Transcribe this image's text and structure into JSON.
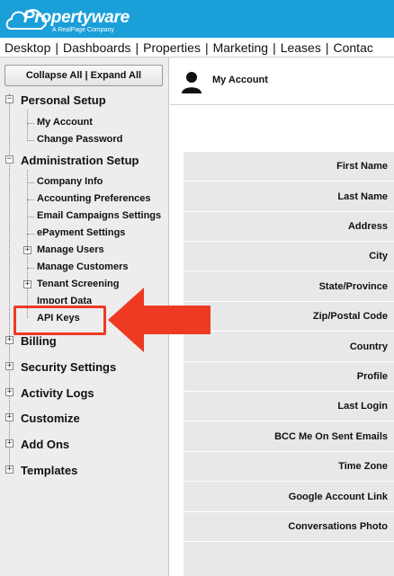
{
  "header": {
    "logo_text": "Propertyware",
    "logo_sub": "A RealPage Company"
  },
  "nav": {
    "items": [
      "Desktop",
      "Dashboards",
      "Properties",
      "Marketing",
      "Leases",
      "Contac"
    ]
  },
  "sidebar": {
    "collapse_all": "Collapse All",
    "expand_all": "Expand All",
    "sections": {
      "personal": "Personal Setup",
      "admin": "Administration Setup",
      "billing": "Billing",
      "security": "Security Settings",
      "activity": "Activity Logs",
      "customize": "Customize",
      "addons": "Add Ons",
      "templates": "Templates"
    },
    "personal_items": [
      "My Account",
      "Change Password"
    ],
    "admin_items": [
      "Company Info",
      "Accounting Preferences",
      "Email Campaigns Settings",
      "ePayment Settings",
      "Manage Users",
      "Manage Customers",
      "Tenant Screening",
      "Import Data",
      "API Keys"
    ]
  },
  "main": {
    "title": "My Account",
    "fields": [
      "First Name",
      "Last Name",
      "Address",
      "City",
      "State/Province",
      "Zip/Postal Code",
      "Country",
      "Profile",
      "Last Login",
      "BCC Me On Sent Emails",
      "Time Zone",
      "Google Account Link",
      "Conversations Photo"
    ]
  },
  "colors": {
    "brand": "#1b9fd9",
    "annotation": "#ee3a23"
  }
}
